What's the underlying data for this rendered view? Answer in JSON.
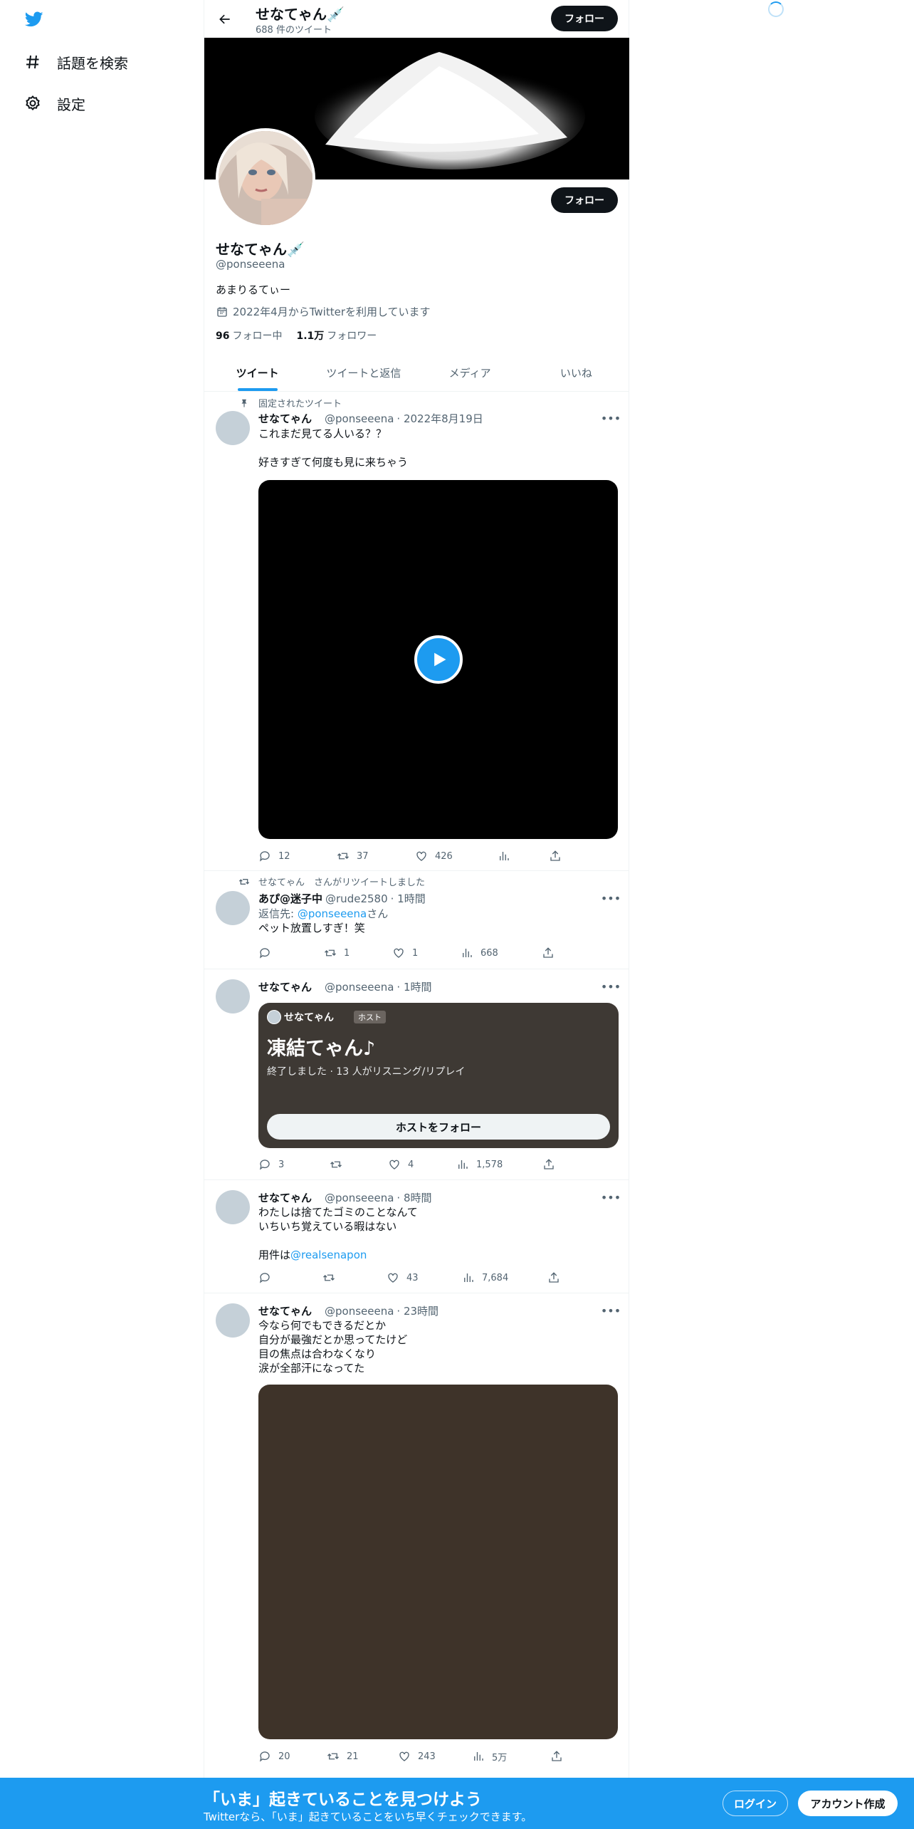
{
  "nav": {
    "items": [
      {
        "label": "話題を検索",
        "icon": "hashtag-icon"
      },
      {
        "label": "設定",
        "icon": "gear-icon"
      }
    ]
  },
  "header": {
    "name": "せなてゃん💉",
    "tweet_count": "688 件のツイート",
    "follow_label": "フォロー"
  },
  "profile": {
    "name": "せなてゃん💉",
    "handle": "@ponseeena",
    "bio": "あまりるてぃー",
    "joined": "2022年4月からTwitterを利用しています",
    "following_count": "96",
    "following_label": "フォロー中",
    "followers_count": "1.1万",
    "followers_label": "フォロワー",
    "follow_label": "フォロー"
  },
  "tabs": [
    {
      "label": "ツイート",
      "active": true
    },
    {
      "label": "ツイートと返信",
      "active": false
    },
    {
      "label": "メディア",
      "active": false
    },
    {
      "label": "いいね",
      "active": false
    }
  ],
  "tweets": [
    {
      "context": "固定されたツイート",
      "name": "せなてゃん",
      "handle": "@ponseeena",
      "time": "· 2022年8月19日",
      "text": "これまだ見てる人いる？？\n\n好きすぎて何度も見に来ちゃう",
      "replies": "12",
      "retweets": "37",
      "likes": "426",
      "views": ""
    },
    {
      "context": "せなてゃん　さんがリツイートしました",
      "name": "あぴ@迷子中",
      "handle": "@rude2580",
      "time": "· 1時間",
      "reply_prefix": "返信先: ",
      "reply_to": "@ponseeena",
      "reply_suffix": "さん",
      "text": "ペット放置しすぎ！笑",
      "replies": "",
      "retweets": "1",
      "likes": "1",
      "views": "668"
    },
    {
      "name": "せなてゃん",
      "handle": "@ponseeena",
      "time": "· 1時間",
      "space": {
        "host_name": "せなてゃん",
        "host_badge": "ホスト",
        "title": "凍結てゃん♪",
        "status": "終了しました · 13 人がリスニング/リプレイ",
        "button": "ホストをフォロー"
      },
      "replies": "3",
      "retweets": "",
      "likes": "4",
      "views": "1,578"
    },
    {
      "name": "せなてゃん",
      "handle": "@ponseeena",
      "time": "· 8時間",
      "text": "わたしは捨てたゴミのことなんて\nいちいち覚えている暇はない\n\n",
      "text_prefix": "用件は",
      "link": "@realsenapon",
      "replies": "",
      "retweets": "",
      "likes": "43",
      "views": "7,684"
    },
    {
      "name": "せなてゃん",
      "handle": "@ponseeena",
      "time": "· 23時間",
      "text": "今なら何でもできるだとか\n自分が最強だとか思ってたけど\n目の焦点は合わなくなり\n涙が全部汗になってた",
      "replies": "20",
      "retweets": "21",
      "likes": "243",
      "views": "5万"
    }
  ],
  "bottom_bar": {
    "title": "「いま」起きていることを見つけよう",
    "subtitle": "Twitterなら、「いま」起きていることをいち早くチェックできます。",
    "login": "ログイン",
    "signup": "アカウント作成"
  },
  "colors": {
    "accent": "#1d9bf0",
    "text": "#0f1419",
    "muted": "#536471",
    "space_card": "#3e3934"
  }
}
